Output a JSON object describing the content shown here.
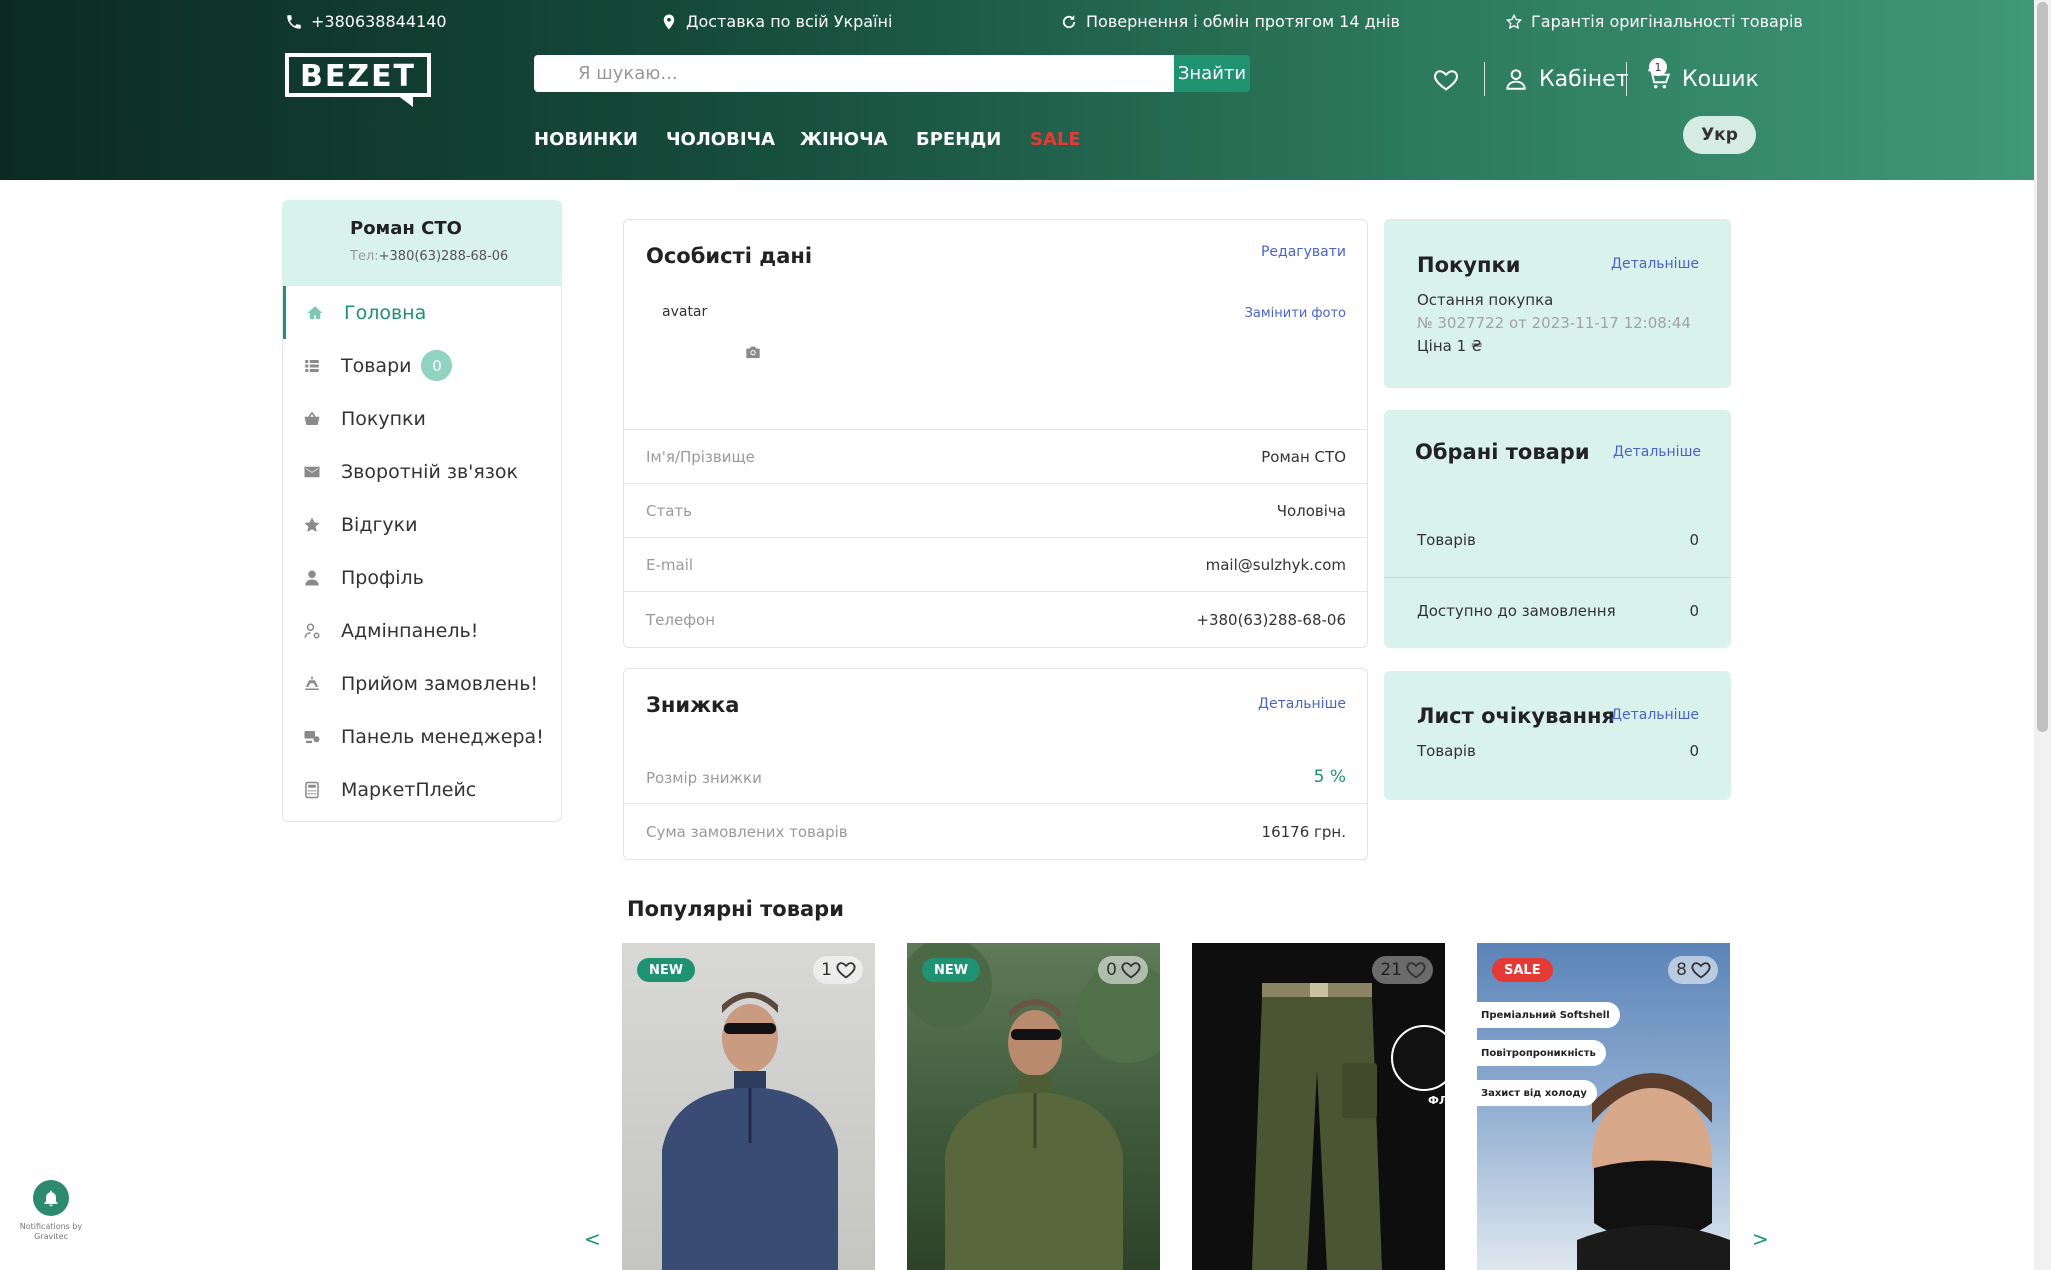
{
  "topbar": {
    "phone": "+380638844140",
    "delivery": "Доставка по всій Україні",
    "returns": "Повернення і обмін протягом 14 днів",
    "guarantee": "Гарантія оригінальності товарів"
  },
  "header": {
    "logo_text": "BEZET",
    "search_placeholder": "Я шукаю...",
    "search_button": "Знайти",
    "cabinet_label": "Кабінет",
    "cart_label": "Кошик",
    "cart_count": "1",
    "lang_label": "Укр",
    "nav": [
      "НОВИНКИ",
      "ЧОЛОВІЧА",
      "ЖІНОЧА",
      "БРЕНДИ",
      "SALE"
    ],
    "sale_color": "#e53935",
    "accent_color": "#1f9272"
  },
  "sidebar": {
    "user_name": "Роман СТО",
    "phone_label": "Тел:",
    "phone": "+380(63)288-68-06",
    "items": [
      {
        "label": "Головна",
        "icon": "home-icon"
      },
      {
        "label": "Товари",
        "icon": "list-icon",
        "badge": "0"
      },
      {
        "label": "Покупки",
        "icon": "basket-icon"
      },
      {
        "label": "Зворотній зв'язок",
        "icon": "envelope-icon"
      },
      {
        "label": "Відгуки",
        "icon": "star-icon"
      },
      {
        "label": "Профіль",
        "icon": "user-icon"
      },
      {
        "label": "Адмінпанель!",
        "icon": "user-gear-icon"
      },
      {
        "label": "Прийом замовлень!",
        "icon": "inbox-icon"
      },
      {
        "label": "Панель менеджера!",
        "icon": "manager-icon"
      },
      {
        "label": "МаркетПлейс",
        "icon": "calculator-icon"
      }
    ]
  },
  "personal": {
    "title": "Особисті дані",
    "edit_link": "Редагувати",
    "avatar_alt": "avatar",
    "change_photo": "Замінити фото",
    "rows": [
      {
        "label": "Ім'я/Прізвище",
        "value": "Роман СТО"
      },
      {
        "label": "Стать",
        "value": "Чоловіча"
      },
      {
        "label": "E-mail",
        "value": "mail@sulzhyk.com"
      },
      {
        "label": "Телефон",
        "value": "+380(63)288-68-06"
      }
    ]
  },
  "discount": {
    "title": "Знижка",
    "details_link": "Детальніше",
    "rows": [
      {
        "label": "Розмір знижки",
        "value": "5 %"
      },
      {
        "label": "Сума замовлених товарів",
        "value": "16176 грн."
      }
    ]
  },
  "purchases": {
    "title": "Покупки",
    "details_link": "Детальніше",
    "last_label": "Остання покупка",
    "order_info": "№ 3027722 от 2023-11-17 12:08:44",
    "price": "Ціна 1 ₴"
  },
  "favorites": {
    "title": "Обрані товари",
    "details_link": "Детальніше",
    "rows": [
      {
        "label": "Товарів",
        "value": "0"
      },
      {
        "label": "Доступно до замовлення",
        "value": "0"
      }
    ]
  },
  "waitlist": {
    "title": "Лист очікування",
    "details_link": "Детальніше",
    "label": "Товарів",
    "value": "0"
  },
  "popular": {
    "title": "Популярні товари",
    "prev": "<",
    "next": ">",
    "products": [
      {
        "tag": "NEW",
        "fav_count": "1",
        "tag_color": "#1f9272"
      },
      {
        "tag": "NEW",
        "fav_count": "0",
        "tag_color": "#1f9272"
      },
      {
        "tag": "",
        "fav_count": "21",
        "label": "ФЛІС"
      },
      {
        "tag": "SALE",
        "fav_count": "8",
        "tag_color": "#e53935",
        "callouts": [
          "Преміальний Softshell",
          "Повітропроникність",
          "Захист від холоду"
        ]
      }
    ]
  },
  "gravitec": {
    "text": "Notifications by Gravitec"
  }
}
